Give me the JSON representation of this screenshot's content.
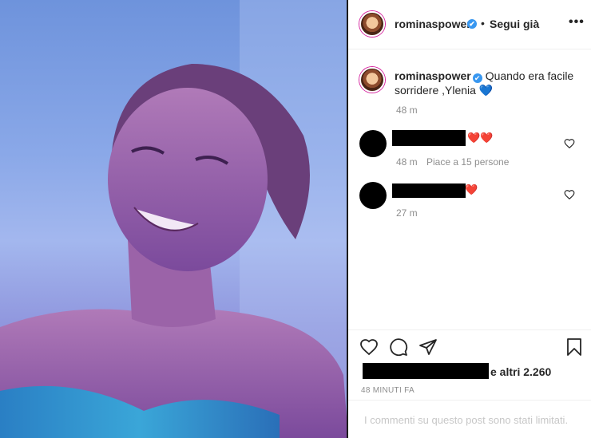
{
  "post": {
    "username": "rominaspower",
    "verified_mark": "✔",
    "follow_separator": "•",
    "follow_label": "Segui già",
    "more_icon": "•••"
  },
  "caption": {
    "username": "rominaspower",
    "verified_mark": "✔",
    "text": "Quando era facile sorridere ,Ylenia",
    "emoji": "💙",
    "time": "48 m"
  },
  "comments": [
    {
      "hearts": "❤️❤️",
      "time": "48 m",
      "likes": "Piace a 15 persone"
    },
    {
      "hearts": "❤️",
      "time": "27 m"
    }
  ],
  "actions": {
    "likes_suffix": "e altri 2.260",
    "timestamp": "48 MINUTI FA",
    "comments_limited": "I commenti su questo post sono stati limitati."
  },
  "colors": {
    "accent": "#3897f0",
    "heart": "#ed4956",
    "muted": "#8e8e8e"
  }
}
